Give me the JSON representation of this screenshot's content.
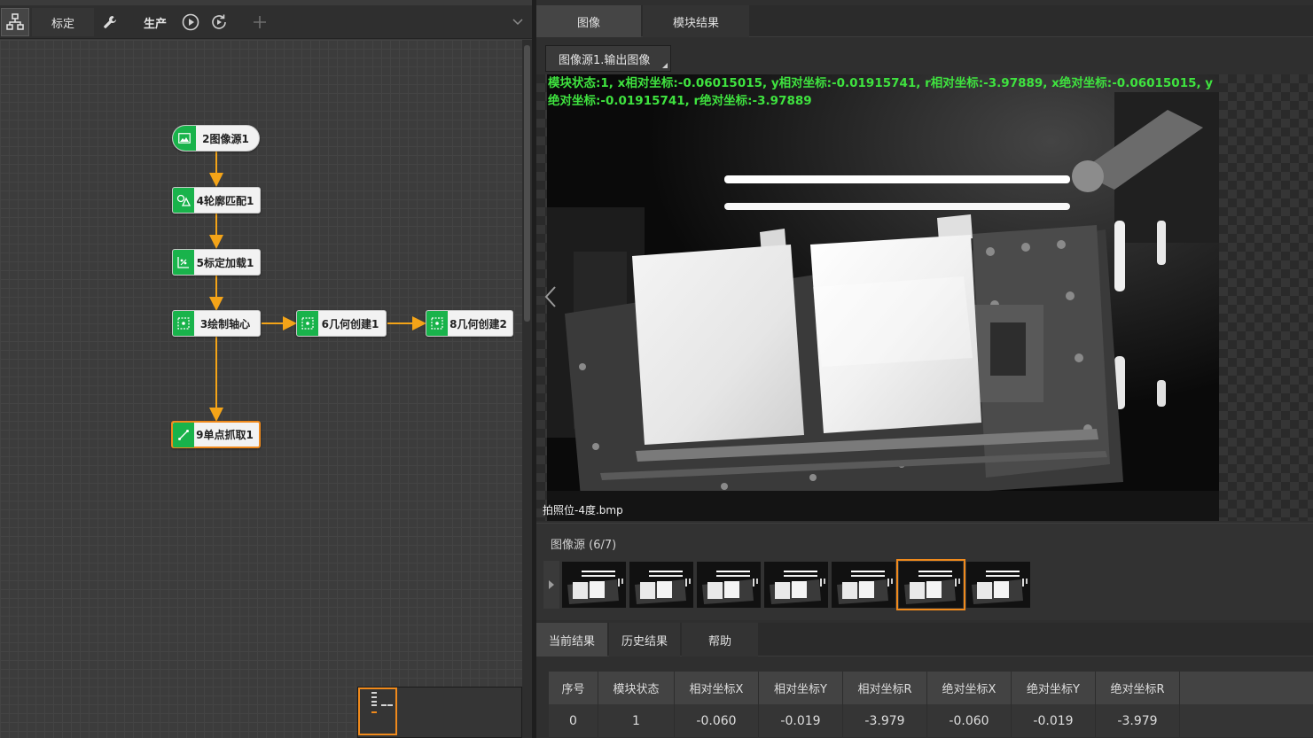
{
  "left_toolbar": {
    "calib_label": "标定",
    "prod_label": "生产"
  },
  "flow": {
    "nodes": [
      {
        "id": "n2",
        "label": "2图像源1",
        "icon": "image-icon"
      },
      {
        "id": "n4",
        "label": "4轮廓匹配1",
        "icon": "shape-match-icon"
      },
      {
        "id": "n5",
        "label": "5标定加载1",
        "icon": "calib-load-icon"
      },
      {
        "id": "n3",
        "label": "3绘制轴心",
        "icon": "geometry-icon"
      },
      {
        "id": "n6",
        "label": "6几何创建1",
        "icon": "geometry-icon"
      },
      {
        "id": "n8",
        "label": "8几何创建2",
        "icon": "geometry-icon"
      },
      {
        "id": "n9",
        "label": "9单点抓取1",
        "icon": "single-point-icon"
      }
    ],
    "selected": "9单点抓取1"
  },
  "right_tabs": [
    "图像",
    "模块结果"
  ],
  "image_view": {
    "source_select": "图像源1.输出图像",
    "overlay_text": "模块状态:1, x相对坐标:-0.06015015, y相对坐标:-0.01915741, r相对坐标:-3.97889, x绝对坐标:-0.06015015, y绝对坐标:-0.01915741, r绝对坐标:-3.97889",
    "filename": "拍照位-4度.bmp"
  },
  "image_source_strip": {
    "label": "图像源 (6/7)",
    "thumbnail_count": 7,
    "active_index": 6
  },
  "result_tabs": [
    "当前结果",
    "历史结果",
    "帮助"
  ],
  "result_table": {
    "columns": [
      "序号",
      "模块状态",
      "相对坐标X",
      "相对坐标Y",
      "相对坐标R",
      "绝对坐标X",
      "绝对坐标Y",
      "绝对坐标R"
    ],
    "rows": [
      [
        "0",
        "1",
        "-0.060",
        "-0.019",
        "-3.979",
        "-0.060",
        "-0.019",
        "-3.979"
      ]
    ]
  },
  "colors": {
    "accent_orange": "#f08a1c",
    "node_green": "#19b34b",
    "overlay_green": "#3fe23f"
  }
}
